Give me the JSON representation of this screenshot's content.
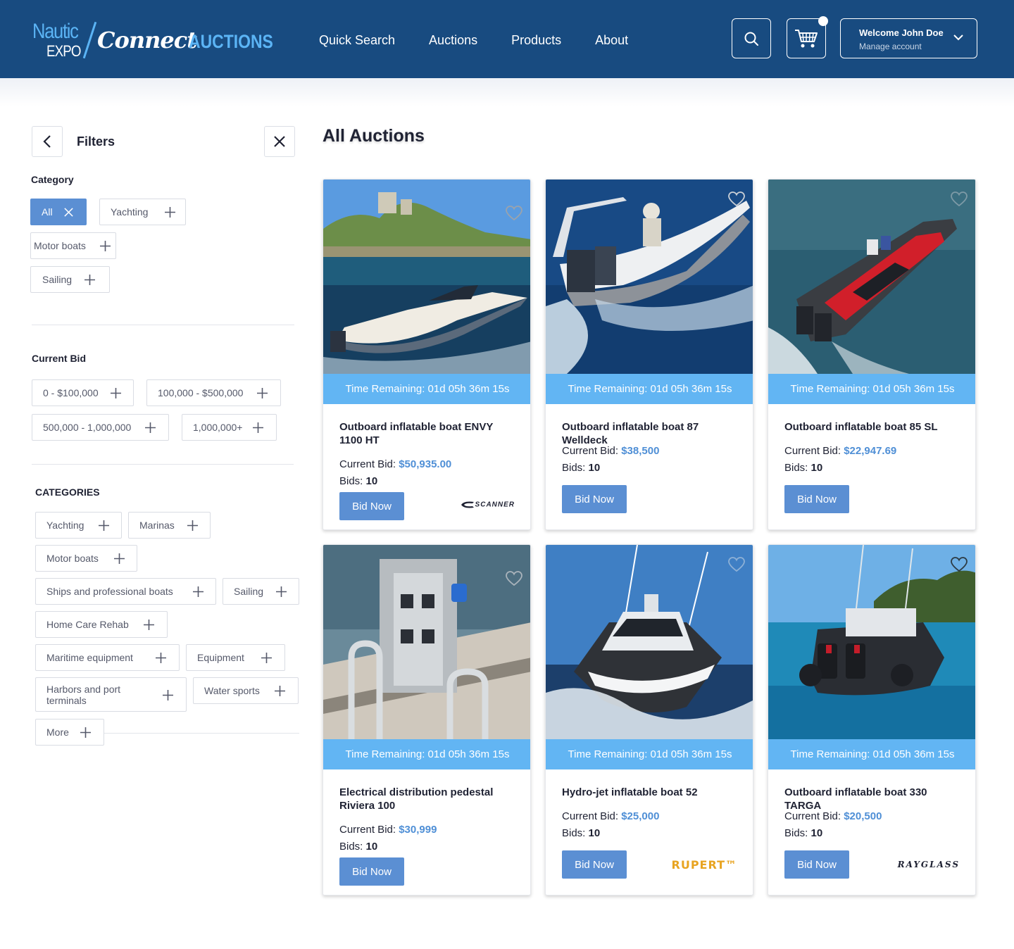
{
  "header": {
    "logo": {
      "nautic": "Nautic",
      "expo": "EXPO",
      "connect": "Connect",
      "auctions": "AUCTIONS"
    },
    "nav": [
      "Quick Search",
      "Auctions",
      "Products",
      "About"
    ],
    "account": {
      "welcome": "Welcome John Doe",
      "manage": "Manage account"
    }
  },
  "filters": {
    "title": "Filters",
    "category_label": "Category",
    "category_chips": [
      "All",
      "Yachting",
      "Motor boats",
      "Sailing"
    ],
    "current_bid_label": "Current Bid",
    "bid_chips": [
      "0 - $100,000",
      "100,000 - $500,000",
      "500,000 - 1,000,000",
      "1,000,000+"
    ],
    "categories_label": "CATEGORIES",
    "categories_chips": [
      "Yachting",
      "Marinas",
      "Motor boats",
      "Ships and professional boats",
      "Sailing",
      "Home Care Rehab",
      "Maritime equipment",
      "Equipment",
      "Harbors and port terminals",
      "Water sports",
      "More"
    ]
  },
  "main": {
    "title": "All Auctions",
    "current_bid_prefix": "Current Bid: ",
    "bids_prefix": "Bids: ",
    "bid_button": "Bid Now",
    "cards": [
      {
        "timer": "Time Remaining: 01d 05h 36m 15s",
        "name": "Outboard inflatable boat ENVY 1100 HT",
        "bid": "$50,935.00",
        "bids": "10",
        "brand": "SCANNER"
      },
      {
        "timer": "Time Remaining: 01d 05h 36m 15s",
        "name": "Outboard inflatable boat 87 Welldeck",
        "bid": "$38,500",
        "bids": "10",
        "brand": ""
      },
      {
        "timer": "Time Remaining: 01d 05h 36m 15s",
        "name": "Outboard inflatable boat 85 SL",
        "bid": "$22,947.69",
        "bids": "10",
        "brand": ""
      },
      {
        "timer": "Time Remaining: 01d 05h 36m 15s",
        "name": "Electrical distribution pedestal Riviera 100",
        "bid": "$30,999",
        "bids": "10",
        "brand": ""
      },
      {
        "timer": "Time Remaining: 01d 05h 36m 15s",
        "name": "Hydro-jet inflatable boat 52",
        "bid": "$25,000",
        "bids": "10",
        "brand": "RUPERT™"
      },
      {
        "timer": "Time Remaining: 01d 05h 36m 15s",
        "name": "Outboard inflatable boat 330 TARGA",
        "bid": "$20,500",
        "bids": "10",
        "brand": "RAYGLASS"
      }
    ]
  },
  "colors": {
    "header_bg": "#184b80",
    "accent": "#5b8fd3",
    "timer_bg": "#62b5f3",
    "bid_amount": "#4f8fd6",
    "logo_blue": "#5bb4f5"
  }
}
